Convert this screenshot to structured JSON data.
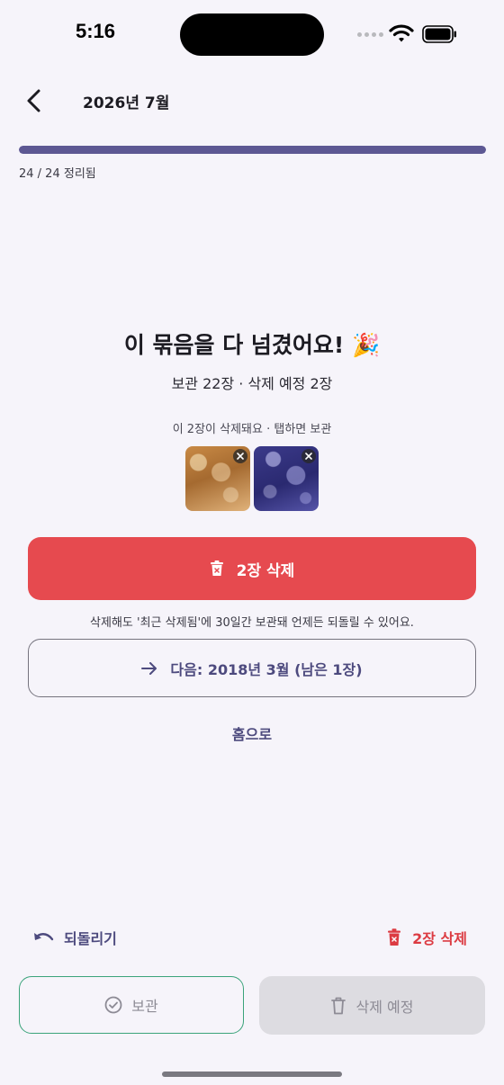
{
  "status_bar": {
    "time": "5:16"
  },
  "header": {
    "title": "2026년 7월",
    "back_icon": "chevron-left-icon"
  },
  "progress": {
    "label": "24 / 24 정리됨",
    "done": 24,
    "total": 24,
    "fraction": 1.0,
    "color": "#5d5893"
  },
  "completion": {
    "title": "이 묶음을 다 넘겼어요! 🎉",
    "summary": "보관 22장 · 삭제 예정 2장",
    "hint": "이 2장이 삭제돼요 · 탭하면 보관"
  },
  "thumbnails": [
    {
      "remove_icon": "close-icon"
    },
    {
      "remove_icon": "close-icon"
    }
  ],
  "actions": {
    "delete_label": "2장 삭제",
    "delete_note": "삭제해도 '최근 삭제됨'에 30일간 보관돼 언제든 되돌릴 수 있어요.",
    "next_label": "다음: 2018년 3월 (남은 1장)",
    "home_label": "홈으로"
  },
  "bottom_bar": {
    "undo_label": "되돌리기",
    "bulk_delete_label": "2장 삭제",
    "keep_label": "보관",
    "pending_label": "삭제 예정"
  },
  "colors": {
    "accent": "#5d5893",
    "danger": "#e64a4f",
    "keep": "#3aa37a"
  }
}
